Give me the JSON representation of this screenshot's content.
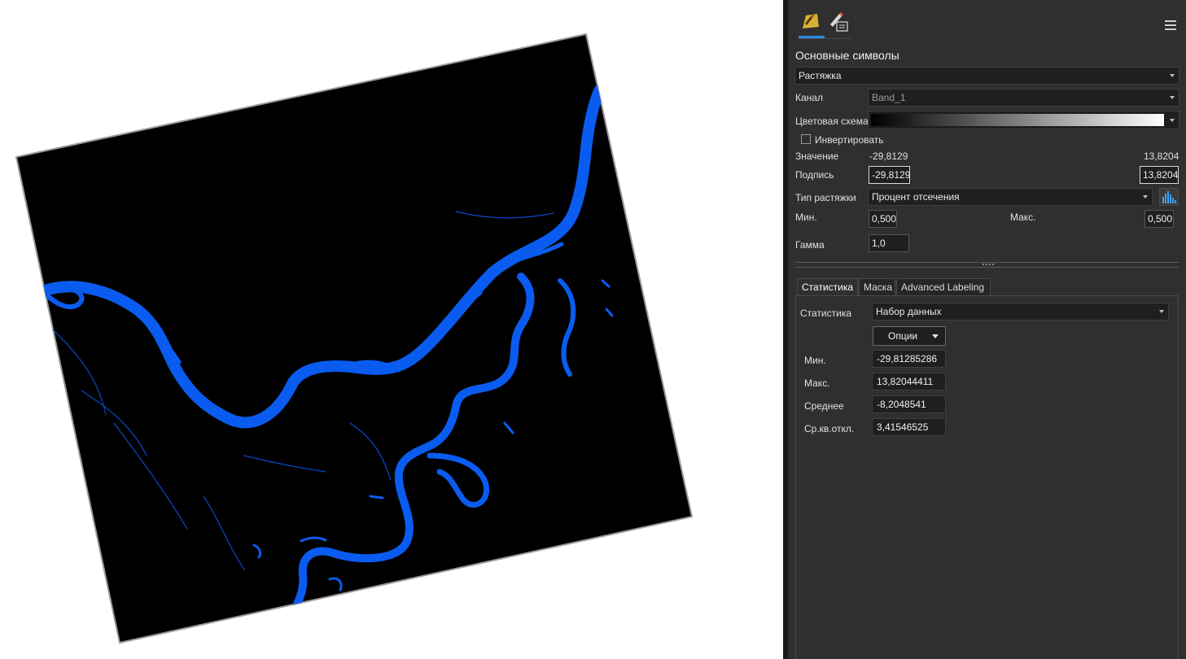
{
  "panel": {
    "title": "Основные символы",
    "menu_icon": "hamburger-menu-icon",
    "toolbar_icons": [
      "symbology-icon",
      "pencil-edit-icon"
    ],
    "renderer": "Растяжка",
    "channel_label": "Канал",
    "channel_value": "Band_1",
    "color_scheme_label": "Цветовая схема",
    "invert_label": "Инвертировать",
    "invert_checked": false,
    "value_label": "Значение",
    "value_min": "-29,8129",
    "value_max": "13,8204",
    "label_label": "Подпись",
    "label_min": "-29,8129",
    "label_max": "13,8204",
    "stretch_type_label": "Тип растяжки",
    "stretch_type_value": "Процент отсечения",
    "histogram_icon": "histogram-icon",
    "min_label": "Мин.",
    "min_value": "0,500",
    "max_label": "Макс.",
    "max_value": "0,500",
    "gamma_label": "Гамма",
    "gamma_value": "1,0"
  },
  "tabs": [
    {
      "label": "Статистика",
      "active": true
    },
    {
      "label": "Маска",
      "active": false
    },
    {
      "label": "Advanced Labeling",
      "active": false
    }
  ],
  "statistics": {
    "label": "Статистика",
    "source": "Набор данных",
    "options_button": "Опции",
    "rows": [
      {
        "label": "Мин.",
        "value": "-29,81285286"
      },
      {
        "label": "Макс.",
        "value": "13,82044411"
      },
      {
        "label": "Среднее",
        "value": "-8,2048541"
      },
      {
        "label": "Ср.кв.откл.",
        "value": "3,41546525"
      }
    ]
  },
  "colors": {
    "water": "#0a5cf0",
    "raster_background": "#000000",
    "panel_background": "#2f2f2f",
    "accent": "#2a8ae6"
  }
}
